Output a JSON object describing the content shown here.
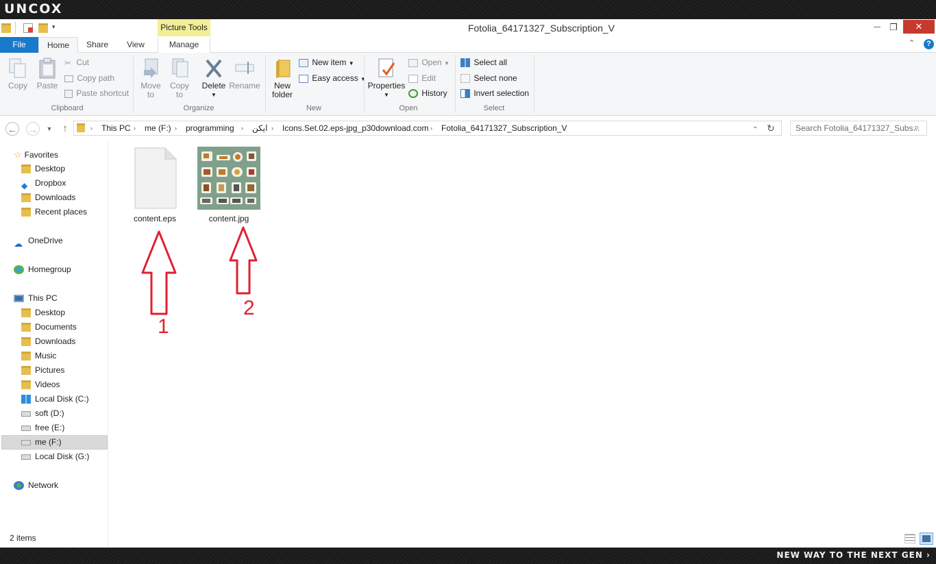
{
  "banner": {
    "logo": "uncox",
    "tagline": "NEW WAY TO THE NEXT GEN ›"
  },
  "window": {
    "title": "Fotolia_64171327_Subscription_V",
    "context_tab": "Picture Tools",
    "controls": {
      "minimize": "—",
      "maximize": "❐",
      "close": "✕"
    }
  },
  "tabs": {
    "file": "File",
    "home": "Home",
    "share": "Share",
    "view": "View",
    "manage": "Manage"
  },
  "ribbon": {
    "clipboard": {
      "label": "Clipboard",
      "copy": "Copy",
      "paste": "Paste",
      "cut": "Cut",
      "copy_path": "Copy path",
      "paste_shortcut": "Paste shortcut"
    },
    "organize": {
      "label": "Organize",
      "move_to": [
        "Move",
        "to"
      ],
      "copy_to": [
        "Copy",
        "to"
      ],
      "delete": "Delete",
      "rename": "Rename"
    },
    "new": {
      "label": "New",
      "new_folder": [
        "New",
        "folder"
      ],
      "new_item": "New item",
      "easy_access": "Easy access"
    },
    "open": {
      "label": "Open",
      "properties": "Properties",
      "open": "Open",
      "edit": "Edit",
      "history": "History"
    },
    "select": {
      "label": "Select",
      "select_all": "Select all",
      "select_none": "Select none",
      "invert_selection": "Invert selection"
    }
  },
  "address": {
    "crumbs": [
      "This PC",
      "me (F:)",
      "programming",
      "ایکن",
      "Icons.Set.02.eps-jpg_p30download.com",
      "Fotolia_64171327_Subscription_V"
    ],
    "search_placeholder": "Search Fotolia_64171327_Subs..."
  },
  "nav": {
    "favorites": "Favorites",
    "fav_items": [
      "Desktop",
      "Dropbox",
      "Downloads",
      "Recent places"
    ],
    "onedrive": "OneDrive",
    "homegroup": "Homegroup",
    "thispc": "This PC",
    "pc_items": [
      "Desktop",
      "Documents",
      "Downloads",
      "Music",
      "Pictures",
      "Videos",
      "Local Disk (C:)",
      "soft (D:)",
      "free (E:)",
      "me (F:)",
      "Local Disk (G:)"
    ],
    "network": "Network"
  },
  "files": [
    {
      "name": "content.eps",
      "type": "document-icon"
    },
    {
      "name": "content.jpg",
      "type": "image-thumbnail"
    }
  ],
  "annotations": {
    "arrow1": "1",
    "arrow2": "2",
    "color": "#e0202e"
  },
  "status": {
    "count": "2 items"
  }
}
